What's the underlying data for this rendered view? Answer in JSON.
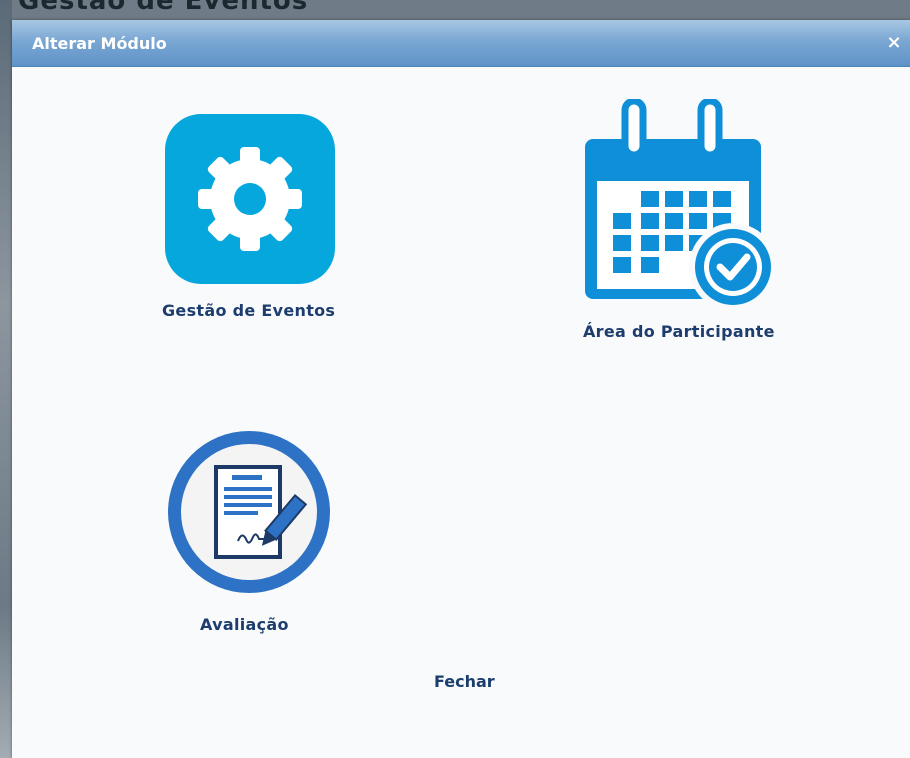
{
  "backdrop": {
    "page_title": "Gestão de Eventos"
  },
  "dialog": {
    "title": "Alterar Módulo",
    "close_glyph": "×",
    "close_icon": "close-icon",
    "modules": [
      {
        "label": "Gestão de Eventos",
        "icon": "gear-icon",
        "color": "#06a7dc"
      },
      {
        "label": "Área do Participante",
        "icon": "calendar-check-icon",
        "color": "#0f8fd8"
      },
      {
        "label": "Avaliação",
        "icon": "signed-document-icon",
        "color": "#2d72c4"
      }
    ],
    "close_link": "Fechar"
  },
  "colors": {
    "titlebar": "#7aa7d3",
    "label_text": "#1c3d6e",
    "content_bg": "#f9fafb"
  }
}
